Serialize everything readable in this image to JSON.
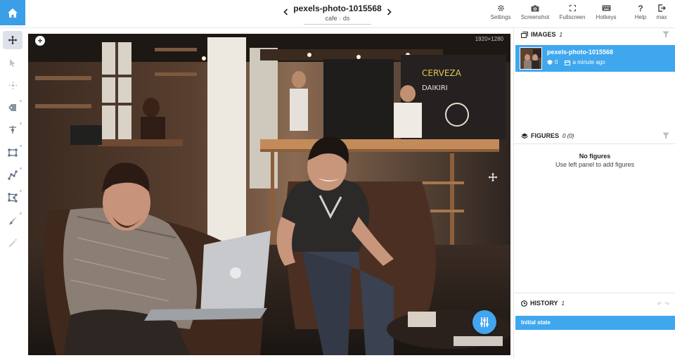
{
  "app": {
    "accent": "#3b9fe8",
    "selected_bg": "#3fa7ee"
  },
  "header": {
    "title": "pexels-photo-1015568",
    "breadcrumb": [
      "cafe",
      "ds"
    ],
    "prev_icon": "chevron-left-icon",
    "next_icon": "chevron-right-icon"
  },
  "toolbar": {
    "settings_label": "Settings",
    "screenshot_label": "Screenshot",
    "fullscreen_label": "Fullscreen",
    "hotkeys_label": "Hotkeys",
    "help_label": "Help",
    "user_label": "max"
  },
  "left_tools": [
    {
      "name": "move-tool",
      "icon": "move-arrows-icon",
      "active": true
    },
    {
      "name": "pointer-tool",
      "icon": "cursor-icon",
      "active": false
    },
    {
      "name": "pan-tool",
      "icon": "crosshair-icon",
      "active": false
    },
    {
      "name": "tag-tool",
      "icon": "tag-icon",
      "active": false
    },
    {
      "name": "point-tool",
      "icon": "point-pin-icon",
      "active": false
    },
    {
      "name": "rectangle-tool",
      "icon": "bounding-box-icon",
      "active": false
    },
    {
      "name": "polyline-tool",
      "icon": "polyline-icon",
      "active": false
    },
    {
      "name": "polygon-tool",
      "icon": "polygon-icon",
      "active": false
    },
    {
      "name": "brush-tool",
      "icon": "brush-icon",
      "active": false
    },
    {
      "name": "magic-wand-tool",
      "icon": "magic-wand-icon",
      "active": false
    }
  ],
  "canvas": {
    "dimensions": "1920×1280",
    "zoom_label": "+"
  },
  "images": {
    "header": "IMAGES",
    "count": "1",
    "items": [
      {
        "name": "pexels-photo-1015568",
        "layers": "0",
        "time": "a minute ago"
      }
    ]
  },
  "figures": {
    "header": "FIGURES",
    "count": "0 (0)",
    "empty_title": "No figures",
    "empty_hint": "Use left panel to add figures"
  },
  "history": {
    "header": "HISTORY",
    "count": "1",
    "items": [
      "Initial state"
    ]
  }
}
